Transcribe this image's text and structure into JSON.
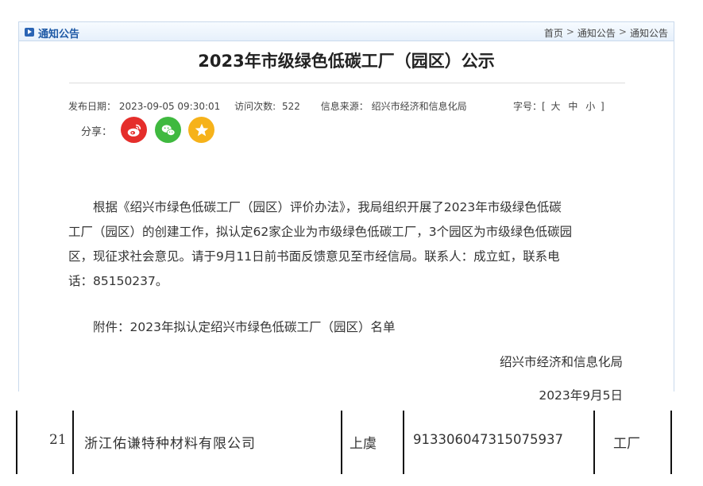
{
  "header": {
    "section_title": "通知公告",
    "breadcrumb": [
      "首页",
      "通知公告",
      "通知公告"
    ],
    "separator": ">"
  },
  "article": {
    "title": "2023年市级绿色低碳工厂（园区）公示",
    "publish_label": "发布日期：",
    "publish_date": "2023-09-05 09:30:01",
    "visits_label": "访问次数:",
    "visits": "522",
    "source_label": "信息来源：",
    "source": "绍兴市经济和信息化局",
    "font_size_label": "字号：[",
    "font_size_options": [
      "大",
      "中",
      "小"
    ],
    "font_size_close": "]",
    "share_label": "分享：",
    "share_icons": [
      "weibo-icon",
      "wechat-icon",
      "favorite-star-icon"
    ],
    "paragraph_line1": "根据《绍兴市绿色低碳工厂（园区）评价办法》，我局组织开展了2023年市级绿色低碳",
    "paragraph_line2": "工厂（园区）的创建工作，拟认定62家企业为市级绿色低碳工厂，3个园区为市级绿色低碳园",
    "paragraph_line3": "区，现征求社会意见。请于9月11日前书面反馈意见至市经信局。联系人：成立虹，联系电",
    "paragraph_line4": "话：85150237。",
    "attachment": "附件：2023年拟认定绍兴市绿色低碳工厂（园区）名单",
    "signature_org": "绍兴市经济和信息化局",
    "signature_date": "2023年9月5日"
  },
  "table_row": {
    "index": "21",
    "company": "浙江佑谦特种材料有限公司",
    "region": "上虞",
    "credit_code": "913306047315075937",
    "type": "工厂"
  },
  "colors": {
    "header_blue": "#1f5aa6",
    "weibo_red": "#e52e2b",
    "wechat_green": "#3fb93f",
    "favorite_orange": "#f6b21a"
  }
}
